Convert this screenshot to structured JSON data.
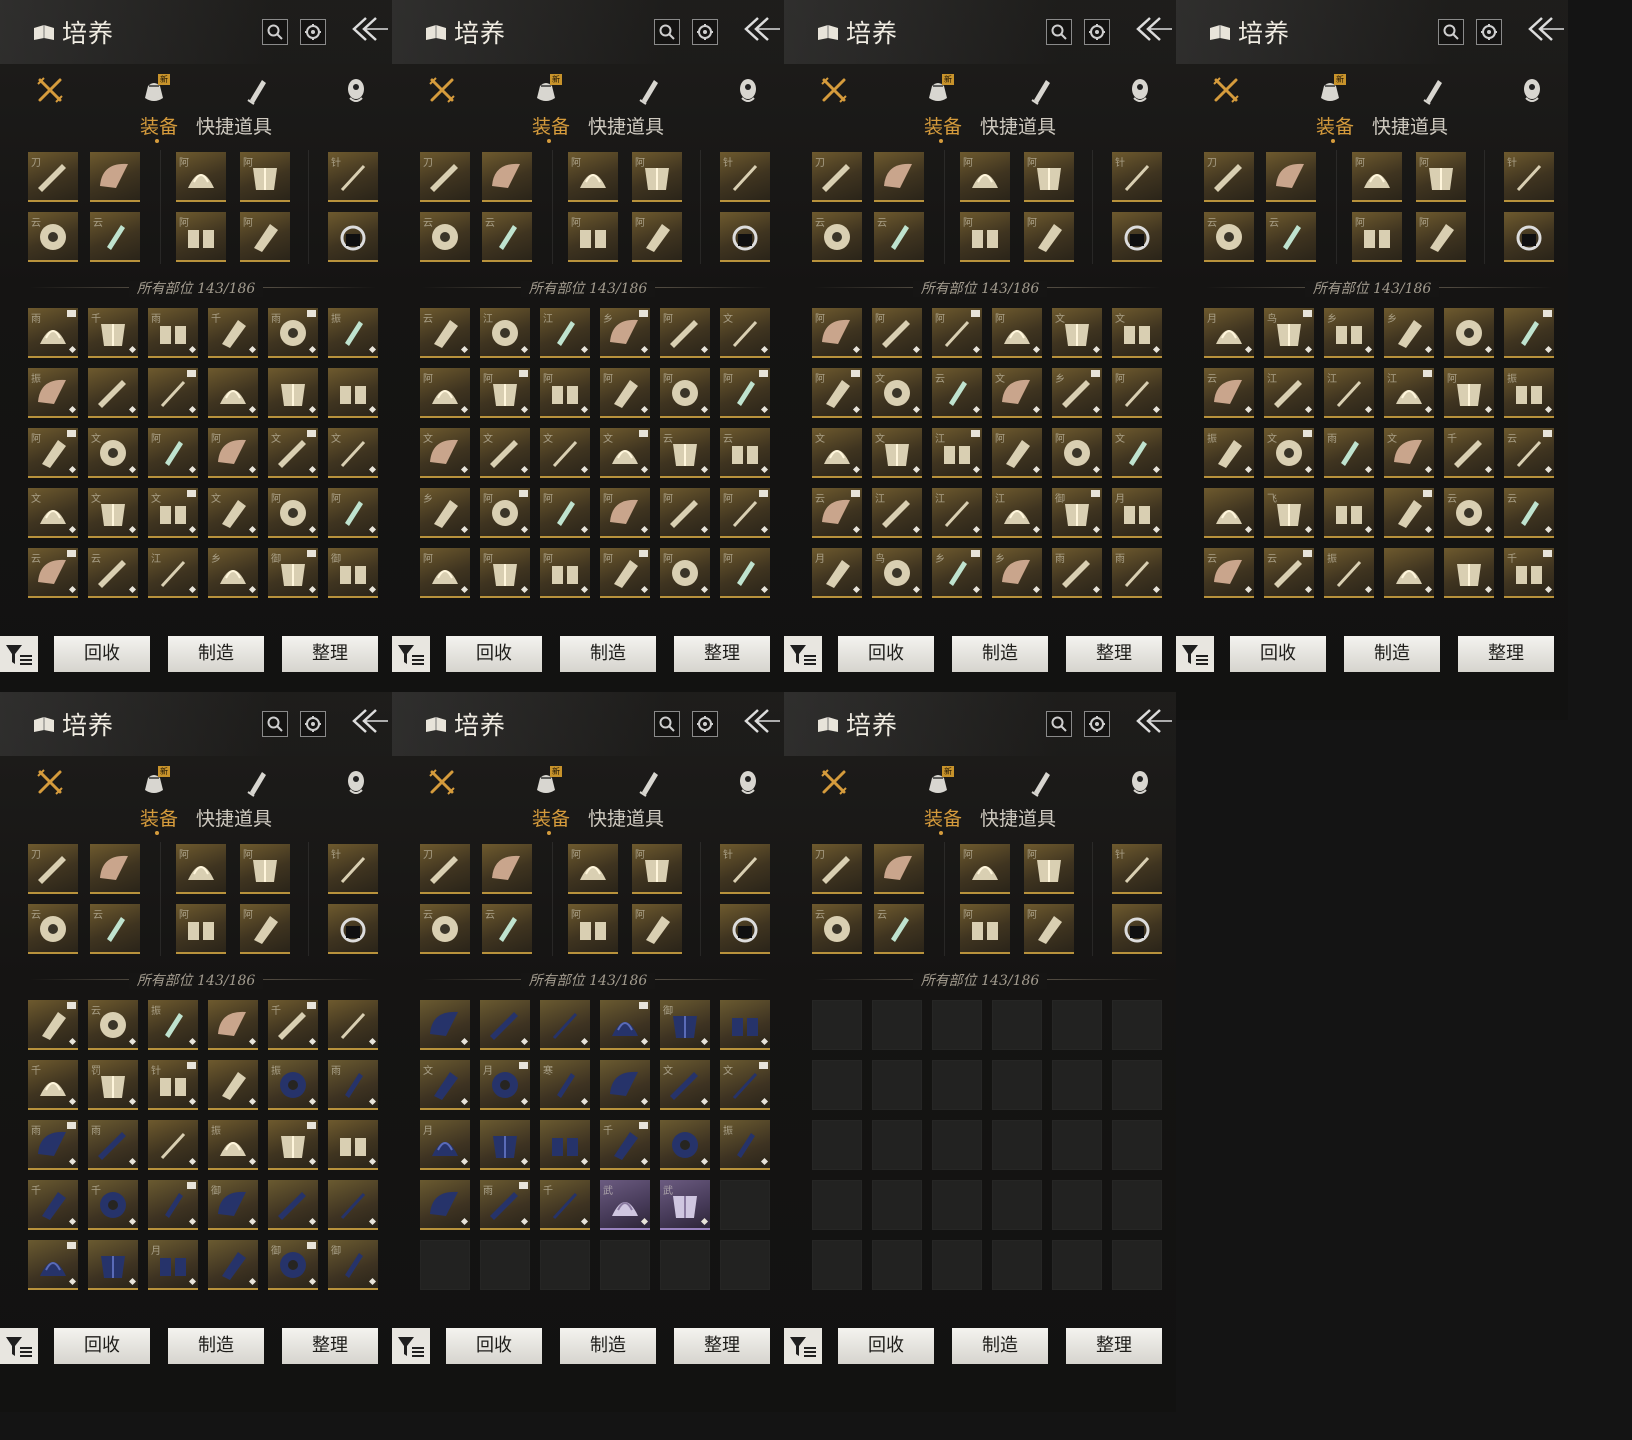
{
  "panel_title": "培养",
  "category_badge": "新",
  "tabs": {
    "equipment": "装备",
    "quick_items": "快捷道具"
  },
  "count_label": "所有部位 143/186",
  "buttons": {
    "recycle": "回收",
    "craft": "制造",
    "organize": "整理"
  },
  "colors": {
    "accent": "#d59b3c",
    "gold_item": "#5b4a28",
    "blue_item": "#2a3048",
    "purple_item": "#4a3d55",
    "empty_slot": "#222221"
  },
  "icons": {
    "title": "book-icon",
    "search": "search-icon",
    "settings": "gear-icon",
    "back": "back-arrow-icon",
    "categories": [
      "crossed-swords-icon",
      "pouch-icon",
      "scroll-icon",
      "token-icon"
    ],
    "filter": "filter-icon"
  },
  "equipped_slots": [
    {
      "kind": "weapon",
      "glyph": "刀"
    },
    {
      "kind": "fan",
      "glyph": ""
    },
    {
      "kind": "hat",
      "glyph": "阿"
    },
    {
      "kind": "armor",
      "glyph": "阿"
    },
    {
      "kind": "stick",
      "glyph": "针"
    },
    {
      "kind": "ring",
      "glyph": "云"
    },
    {
      "kind": "jade",
      "glyph": "云"
    },
    {
      "kind": "bracer",
      "glyph": "阿"
    },
    {
      "kind": "gauntlet",
      "glyph": "阿"
    },
    {
      "kind": "bag",
      "glyph": ""
    }
  ],
  "pages": [
    {
      "items": [
        {
          "c": "gold",
          "g": "雨"
        },
        {
          "c": "gold",
          "g": "千"
        },
        {
          "c": "gold",
          "g": "雨"
        },
        {
          "c": "gold",
          "g": "千"
        },
        {
          "c": "gold",
          "g": "雨"
        },
        {
          "c": "gold",
          "g": "振"
        },
        {
          "c": "gold",
          "g": "振"
        },
        {
          "c": "gold",
          "g": ""
        },
        {
          "c": "gold",
          "g": ""
        },
        {
          "c": "gold",
          "g": ""
        },
        {
          "c": "gold",
          "g": ""
        },
        {
          "c": "gold",
          "g": ""
        },
        {
          "c": "gold",
          "g": "阿"
        },
        {
          "c": "gold",
          "g": "文"
        },
        {
          "c": "gold",
          "g": "阿"
        },
        {
          "c": "gold",
          "g": "阿"
        },
        {
          "c": "gold",
          "g": "文"
        },
        {
          "c": "gold",
          "g": "文"
        },
        {
          "c": "gold",
          "g": "文"
        },
        {
          "c": "gold",
          "g": "文"
        },
        {
          "c": "gold",
          "g": "文"
        },
        {
          "c": "gold",
          "g": "文"
        },
        {
          "c": "gold",
          "g": "阿"
        },
        {
          "c": "gold",
          "g": "阿"
        },
        {
          "c": "gold",
          "g": "云"
        },
        {
          "c": "gold",
          "g": "云"
        },
        {
          "c": "gold",
          "g": "江"
        },
        {
          "c": "gold",
          "g": "乡"
        },
        {
          "c": "gold",
          "g": "御"
        },
        {
          "c": "gold",
          "g": "御"
        }
      ]
    },
    {
      "items": [
        {
          "c": "gold",
          "g": "云"
        },
        {
          "c": "gold",
          "g": "江"
        },
        {
          "c": "gold",
          "g": "江"
        },
        {
          "c": "gold",
          "g": "乡"
        },
        {
          "c": "gold",
          "g": "阿"
        },
        {
          "c": "gold",
          "g": "文"
        },
        {
          "c": "gold",
          "g": "阿"
        },
        {
          "c": "gold",
          "g": "阿"
        },
        {
          "c": "gold",
          "g": "阿"
        },
        {
          "c": "gold",
          "g": "阿"
        },
        {
          "c": "gold",
          "g": "阿"
        },
        {
          "c": "gold",
          "g": "阿"
        },
        {
          "c": "gold",
          "g": "文"
        },
        {
          "c": "gold",
          "g": "文"
        },
        {
          "c": "gold",
          "g": "文"
        },
        {
          "c": "gold",
          "g": "文"
        },
        {
          "c": "gold",
          "g": "云"
        },
        {
          "c": "gold",
          "g": "云"
        },
        {
          "c": "gold",
          "g": "乡"
        },
        {
          "c": "gold",
          "g": "阿"
        },
        {
          "c": "gold",
          "g": "阿"
        },
        {
          "c": "gold",
          "g": "阿"
        },
        {
          "c": "gold",
          "g": "阿"
        },
        {
          "c": "gold",
          "g": "阿"
        },
        {
          "c": "gold",
          "g": "阿"
        },
        {
          "c": "gold",
          "g": "阿"
        },
        {
          "c": "gold",
          "g": "阿"
        },
        {
          "c": "gold",
          "g": "阿"
        },
        {
          "c": "gold",
          "g": "阿"
        },
        {
          "c": "gold",
          "g": "阿"
        }
      ]
    },
    {
      "items": [
        {
          "c": "gold",
          "g": "阿"
        },
        {
          "c": "gold",
          "g": "阿"
        },
        {
          "c": "gold",
          "g": "阿"
        },
        {
          "c": "gold",
          "g": "阿"
        },
        {
          "c": "gold",
          "g": "文"
        },
        {
          "c": "gold",
          "g": "文"
        },
        {
          "c": "gold",
          "g": "阿"
        },
        {
          "c": "gold",
          "g": "文"
        },
        {
          "c": "gold",
          "g": "云"
        },
        {
          "c": "gold",
          "g": "文"
        },
        {
          "c": "gold",
          "g": "乡"
        },
        {
          "c": "gold",
          "g": "阿"
        },
        {
          "c": "gold",
          "g": "文"
        },
        {
          "c": "gold",
          "g": "文"
        },
        {
          "c": "gold",
          "g": "江"
        },
        {
          "c": "gold",
          "g": "阿"
        },
        {
          "c": "gold",
          "g": "阿"
        },
        {
          "c": "gold",
          "g": "文"
        },
        {
          "c": "gold",
          "g": "云"
        },
        {
          "c": "gold",
          "g": "江"
        },
        {
          "c": "gold",
          "g": "江"
        },
        {
          "c": "gold",
          "g": "江"
        },
        {
          "c": "gold",
          "g": "御"
        },
        {
          "c": "gold",
          "g": "月"
        },
        {
          "c": "gold",
          "g": "月"
        },
        {
          "c": "gold",
          "g": "鸟"
        },
        {
          "c": "gold",
          "g": "乡"
        },
        {
          "c": "gold",
          "g": "乡"
        },
        {
          "c": "gold",
          "g": "雨"
        },
        {
          "c": "gold",
          "g": "雨"
        }
      ]
    },
    {
      "items": [
        {
          "c": "gold",
          "g": "月"
        },
        {
          "c": "gold",
          "g": "鸟"
        },
        {
          "c": "gold",
          "g": "乡"
        },
        {
          "c": "gold",
          "g": "乡"
        },
        {
          "c": "gold",
          "g": ""
        },
        {
          "c": "gold",
          "g": ""
        },
        {
          "c": "gold",
          "g": "云"
        },
        {
          "c": "gold",
          "g": "江"
        },
        {
          "c": "gold",
          "g": "江"
        },
        {
          "c": "gold",
          "g": "江"
        },
        {
          "c": "gold",
          "g": "阿"
        },
        {
          "c": "gold",
          "g": "振"
        },
        {
          "c": "gold",
          "g": "振"
        },
        {
          "c": "gold",
          "g": "文"
        },
        {
          "c": "gold",
          "g": "雨"
        },
        {
          "c": "gold",
          "g": "文"
        },
        {
          "c": "gold",
          "g": "千"
        },
        {
          "c": "gold",
          "g": "云"
        },
        {
          "c": "gold",
          "g": ""
        },
        {
          "c": "gold",
          "g": "飞"
        },
        {
          "c": "gold",
          "g": ""
        },
        {
          "c": "gold",
          "g": ""
        },
        {
          "c": "gold",
          "g": "云"
        },
        {
          "c": "gold",
          "g": "云"
        },
        {
          "c": "gold",
          "g": "云"
        },
        {
          "c": "gold",
          "g": "云"
        },
        {
          "c": "gold",
          "g": "振"
        },
        {
          "c": "gold",
          "g": ""
        },
        {
          "c": "gold",
          "g": ""
        },
        {
          "c": "gold",
          "g": "千"
        }
      ]
    },
    {
      "items": [
        {
          "c": "gold",
          "g": ""
        },
        {
          "c": "gold",
          "g": "云"
        },
        {
          "c": "gold",
          "g": "振"
        },
        {
          "c": "gold",
          "g": ""
        },
        {
          "c": "gold",
          "g": "千"
        },
        {
          "c": "gold",
          "g": ""
        },
        {
          "c": "gold",
          "g": "千"
        },
        {
          "c": "gold",
          "g": "罚"
        },
        {
          "c": "gold",
          "g": "针"
        },
        {
          "c": "gold",
          "g": ""
        },
        {
          "c": "blue",
          "g": "振"
        },
        {
          "c": "blue",
          "g": "雨"
        },
        {
          "c": "blue",
          "g": "雨"
        },
        {
          "c": "blue",
          "g": "雨"
        },
        {
          "c": "gold",
          "g": ""
        },
        {
          "c": "gold",
          "g": "振"
        },
        {
          "c": "gold",
          "g": ""
        },
        {
          "c": "gold",
          "g": ""
        },
        {
          "c": "blue",
          "g": "千"
        },
        {
          "c": "blue",
          "g": "千"
        },
        {
          "c": "blue",
          "g": ""
        },
        {
          "c": "blue",
          "g": "御"
        },
        {
          "c": "blue",
          "g": ""
        },
        {
          "c": "blue",
          "g": ""
        },
        {
          "c": "blue",
          "g": ""
        },
        {
          "c": "blue",
          "g": ""
        },
        {
          "c": "blue",
          "g": "月"
        },
        {
          "c": "blue",
          "g": ""
        },
        {
          "c": "blue",
          "g": "御"
        },
        {
          "c": "blue",
          "g": "御"
        }
      ]
    },
    {
      "items": [
        {
          "c": "blue",
          "g": ""
        },
        {
          "c": "blue",
          "g": ""
        },
        {
          "c": "blue",
          "g": ""
        },
        {
          "c": "blue",
          "g": ""
        },
        {
          "c": "blue",
          "g": "御"
        },
        {
          "c": "blue",
          "g": ""
        },
        {
          "c": "blue",
          "g": "文"
        },
        {
          "c": "blue",
          "g": "月"
        },
        {
          "c": "blue",
          "g": "寒"
        },
        {
          "c": "blue",
          "g": ""
        },
        {
          "c": "blue",
          "g": "文"
        },
        {
          "c": "blue",
          "g": "文"
        },
        {
          "c": "blue",
          "g": "月"
        },
        {
          "c": "blue",
          "g": ""
        },
        {
          "c": "blue",
          "g": ""
        },
        {
          "c": "blue",
          "g": "千"
        },
        {
          "c": "blue",
          "g": ""
        },
        {
          "c": "blue",
          "g": "振"
        },
        {
          "c": "blue",
          "g": ""
        },
        {
          "c": "blue",
          "g": "雨"
        },
        {
          "c": "blue",
          "g": "千"
        },
        {
          "c": "purple",
          "g": "武"
        },
        {
          "c": "purple",
          "g": "武"
        },
        {
          "c": "empty",
          "g": ""
        },
        {
          "c": "empty",
          "g": ""
        },
        {
          "c": "empty",
          "g": ""
        },
        {
          "c": "empty",
          "g": ""
        },
        {
          "c": "empty",
          "g": ""
        },
        {
          "c": "empty",
          "g": ""
        },
        {
          "c": "empty",
          "g": ""
        }
      ]
    },
    {
      "items": [
        {
          "c": "empty",
          "g": ""
        },
        {
          "c": "empty",
          "g": ""
        },
        {
          "c": "empty",
          "g": ""
        },
        {
          "c": "empty",
          "g": ""
        },
        {
          "c": "empty",
          "g": ""
        },
        {
          "c": "empty",
          "g": ""
        },
        {
          "c": "empty",
          "g": ""
        },
        {
          "c": "empty",
          "g": ""
        },
        {
          "c": "empty",
          "g": ""
        },
        {
          "c": "empty",
          "g": ""
        },
        {
          "c": "empty",
          "g": ""
        },
        {
          "c": "empty",
          "g": ""
        },
        {
          "c": "empty",
          "g": ""
        },
        {
          "c": "empty",
          "g": ""
        },
        {
          "c": "empty",
          "g": ""
        },
        {
          "c": "empty",
          "g": ""
        },
        {
          "c": "empty",
          "g": ""
        },
        {
          "c": "empty",
          "g": ""
        },
        {
          "c": "empty",
          "g": ""
        },
        {
          "c": "empty",
          "g": ""
        },
        {
          "c": "empty",
          "g": ""
        },
        {
          "c": "empty",
          "g": ""
        },
        {
          "c": "empty",
          "g": ""
        },
        {
          "c": "empty",
          "g": ""
        },
        {
          "c": "empty",
          "g": ""
        },
        {
          "c": "empty",
          "g": ""
        },
        {
          "c": "empty",
          "g": ""
        },
        {
          "c": "empty",
          "g": ""
        },
        {
          "c": "empty",
          "g": ""
        },
        {
          "c": "empty",
          "g": ""
        }
      ]
    }
  ]
}
